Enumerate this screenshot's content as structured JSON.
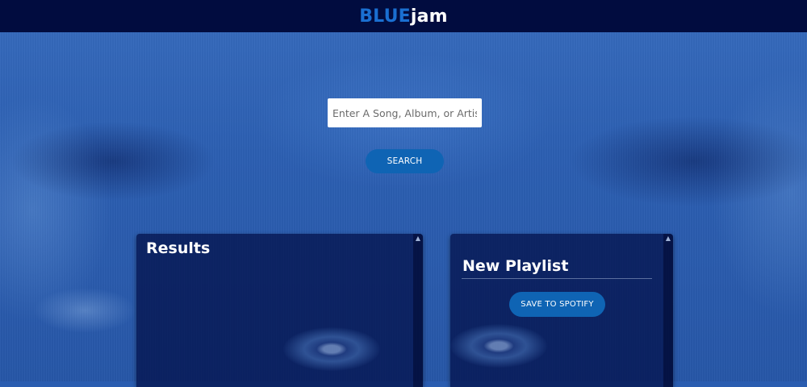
{
  "header": {
    "logo_part1": "BLUE",
    "logo_part2": "jam",
    "colors": {
      "bar": "#010c3f",
      "logo_accent": "#1a6fd1"
    }
  },
  "search": {
    "placeholder": "Enter A Song, Album, or Artist",
    "button_label": "SEARCH"
  },
  "results": {
    "title": "Results",
    "items": []
  },
  "playlist": {
    "name": "New Playlist",
    "save_label": "SAVE TO SPOTIFY",
    "tracks": []
  },
  "icons": {
    "scroll_up": "chevron-up-icon"
  },
  "colors": {
    "primary_button": "#0f64b4",
    "panel_bg": "#010e46"
  }
}
